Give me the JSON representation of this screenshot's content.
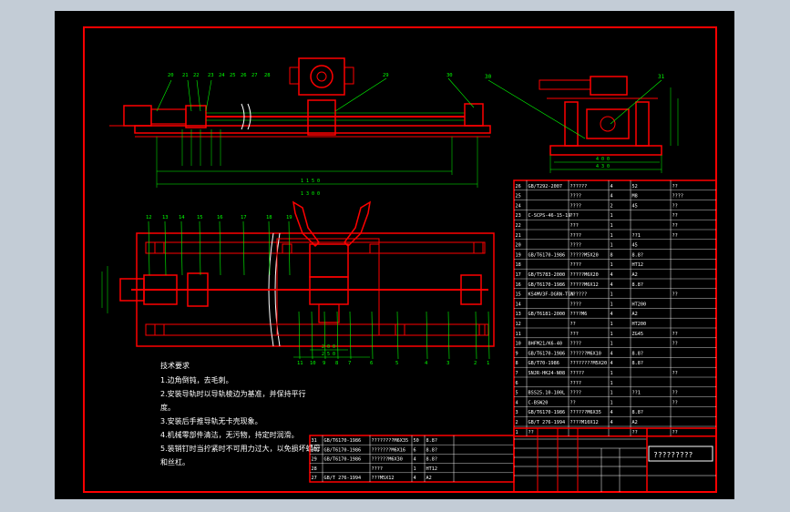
{
  "drawing": {
    "tech_requirements": {
      "title": "技术要求",
      "lines": [
        "1.边角倒钝，去毛刺。",
        "2.安装导轨时以导轨棱边为基准，并保持平行",
        "度。",
        "3.安装后手推导轨无卡壳现象。",
        "4.机械零部件清洁，无污物，持定时润滑。",
        "5.装销钉时当拧紧时不可用力过大，以免损坏螺母",
        "和丝杠。"
      ]
    },
    "bom_right": [
      {
        "no": "26",
        "code": "GB/T292-2007",
        "name": "??????",
        "qty": "4",
        "mat": "52",
        "note": "??"
      },
      {
        "no": "25",
        "code": "",
        "name": "????",
        "qty": "4",
        "mat": "M8",
        "note": "????"
      },
      {
        "no": "24",
        "code": "",
        "name": "????",
        "qty": "2",
        "mat": "45",
        "note": "??"
      },
      {
        "no": "23",
        "code": "C-SCPS-46-15-19",
        "name": "???",
        "qty": "1",
        "mat": "",
        "note": "??"
      },
      {
        "no": "22",
        "code": "",
        "name": "???",
        "qty": "1",
        "mat": "",
        "note": "??"
      },
      {
        "no": "21",
        "code": "",
        "name": "????",
        "qty": "1",
        "mat": "??1",
        "note": "??"
      },
      {
        "no": "20",
        "code": "",
        "name": "????",
        "qty": "1",
        "mat": "45",
        "note": ""
      },
      {
        "no": "19",
        "code": "GB/T6170-1986",
        "name": "?????M5X20",
        "qty": "8",
        "mat": "8.8?",
        "note": ""
      },
      {
        "no": "18",
        "code": "",
        "name": "????",
        "qty": "1",
        "mat": "HT12",
        "note": ""
      },
      {
        "no": "17",
        "code": "GB/T5783-2000",
        "name": "?????M6X20",
        "qty": "4",
        "mat": "A2",
        "note": ""
      },
      {
        "no": "16",
        "code": "GB/T6170-1986",
        "name": "?????M6X12",
        "qty": "4",
        "mat": "8.8?",
        "note": ""
      },
      {
        "no": "15",
        "code": "KS4MV3F-DGRN-TGN",
        "name": "??????",
        "qty": "1",
        "mat": "",
        "note": "??"
      },
      {
        "no": "14",
        "code": "",
        "name": "????",
        "qty": "1",
        "mat": "HT200",
        "note": ""
      },
      {
        "no": "13",
        "code": "GB/T6181-2000",
        "name": "????M6",
        "qty": "4",
        "mat": "A2",
        "note": ""
      },
      {
        "no": "12",
        "code": "",
        "name": "??",
        "qty": "1",
        "mat": "HT200",
        "note": ""
      },
      {
        "no": "11",
        "code": "",
        "name": "???",
        "qty": "1",
        "mat": "ZG45",
        "note": "??"
      },
      {
        "no": "10",
        "code": "BHFM21/K6-40",
        "name": "????",
        "qty": "1",
        "mat": "",
        "note": "??"
      },
      {
        "no": "9",
        "code": "GB/T6170-1986",
        "name": "??????M6X10",
        "qty": "4",
        "mat": "8.8?",
        "note": ""
      },
      {
        "no": "8",
        "code": "GB/T70-1986",
        "name": "????????M5X20",
        "qty": "4",
        "mat": "8.8?",
        "note": ""
      },
      {
        "no": "7",
        "code": "SNJR-HK24-N08",
        "name": "?????",
        "qty": "1",
        "mat": "",
        "note": "??"
      },
      {
        "no": "6",
        "code": "",
        "name": "????",
        "qty": "1",
        "mat": "",
        "note": ""
      },
      {
        "no": "5",
        "code": "BSS25.10-100L",
        "name": "????",
        "qty": "1",
        "mat": "??1",
        "note": "??"
      },
      {
        "no": "4",
        "code": "C-BSW20",
        "name": "??",
        "qty": "1",
        "mat": "",
        "note": "??"
      },
      {
        "no": "3",
        "code": "GB/T6170-1986",
        "name": "??????M6X35",
        "qty": "4",
        "mat": "8.8?",
        "note": ""
      },
      {
        "no": "2",
        "code": "GB/T 276-1994",
        "name": "????M10X12",
        "qty": "4",
        "mat": "A2",
        "note": ""
      },
      {
        "no": "1",
        "code": "??",
        "name": "",
        "qty": "",
        "mat": "??",
        "note": "??"
      }
    ],
    "bom_bottom": [
      {
        "no": "31",
        "code": "GB/T6170-1986",
        "name": "????????M6X35",
        "qty": "50",
        "mat": "8.8?"
      },
      {
        "no": "30",
        "code": "GB/T6170-1986",
        "name": "???????M6X16",
        "qty": "6",
        "mat": "8.8?"
      },
      {
        "no": "29",
        "code": "GB/T6170-1986",
        "name": "??????M6X30",
        "qty": "4",
        "mat": "8.8?"
      },
      {
        "no": "28",
        "code": "",
        "name": "????",
        "qty": "1",
        "mat": "HT12"
      },
      {
        "no": "27",
        "code": "GB/T 276-1994",
        "name": "???M5X12",
        "qty": "4",
        "mat": "A2"
      }
    ],
    "title_block": {
      "title": "?????????"
    },
    "dims": {
      "front_span": "1 3 0 0",
      "front_sub": "1 1 5 0",
      "side_w1": "4 0 0",
      "side_w2": "4 3 0",
      "top_a": "2 0 0",
      "top_b": "2 5 0"
    },
    "balloons_front": [
      "20",
      "21",
      "22",
      "23",
      "24",
      "25",
      "26",
      "27",
      "28",
      "29",
      "30"
    ],
    "balloons_top": [
      "12",
      "13",
      "14",
      "15",
      "16",
      "17",
      "18",
      "19",
      "11",
      "10",
      "9",
      "8",
      "7",
      "6",
      "5",
      "4",
      "3",
      "2",
      "1"
    ]
  }
}
